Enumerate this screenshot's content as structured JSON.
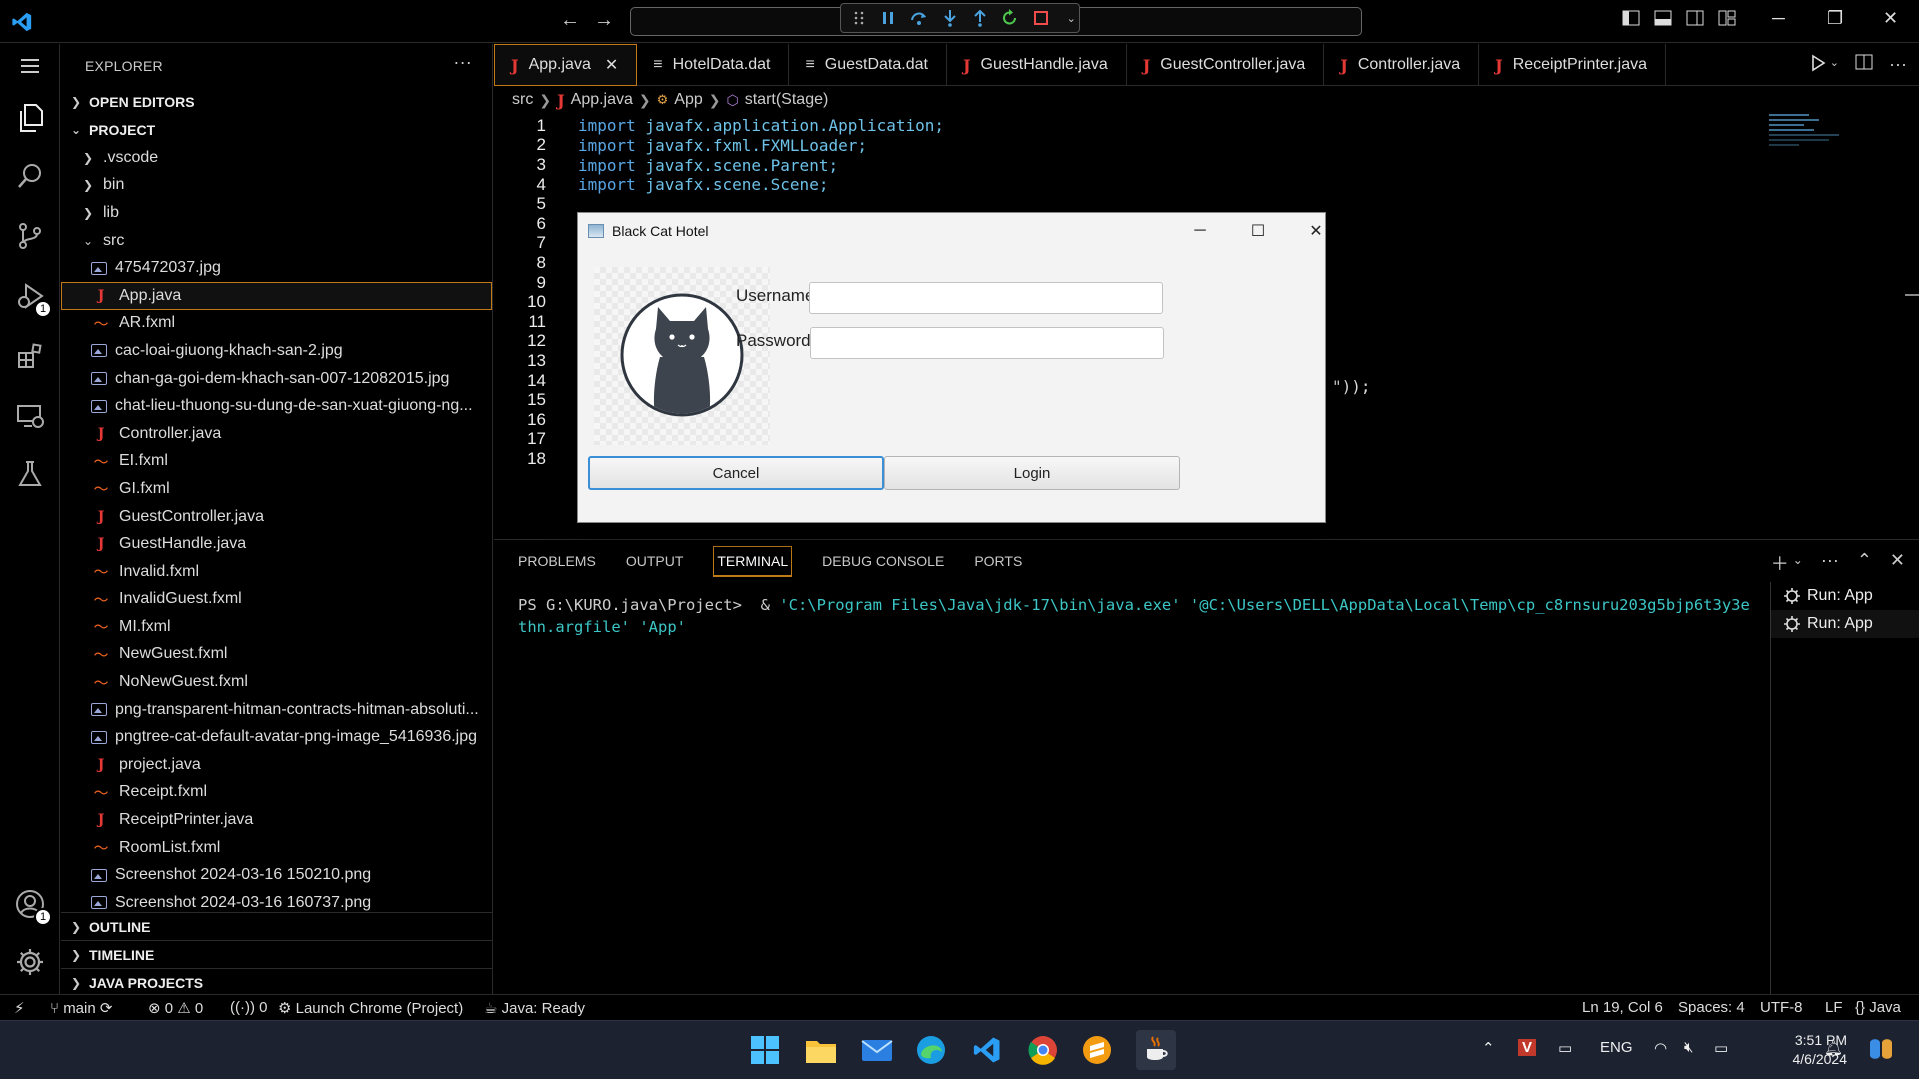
{
  "titlebar": {
    "debug_controls": [
      "drag-handle",
      "pause",
      "step-over",
      "step-into",
      "step-out",
      "restart",
      "stop"
    ]
  },
  "sidebar": {
    "title": "EXPLORER",
    "more": "···",
    "open_editors": "OPEN EDITORS",
    "project": "PROJECT",
    "folders": [
      ".vscode",
      "bin",
      "lib"
    ],
    "src_folder": "src",
    "files": [
      {
        "name": "475472037.jpg",
        "type": "img"
      },
      {
        "name": "App.java",
        "type": "java",
        "active": true
      },
      {
        "name": "AR.fxml",
        "type": "xml"
      },
      {
        "name": "cac-loai-giuong-khach-san-2.jpg",
        "type": "img"
      },
      {
        "name": "chan-ga-goi-dem-khach-san-007-12082015.jpg",
        "type": "img"
      },
      {
        "name": "chat-lieu-thuong-su-dung-de-san-xuat-giuong-ng...",
        "type": "img"
      },
      {
        "name": "Controller.java",
        "type": "java"
      },
      {
        "name": "EI.fxml",
        "type": "xml"
      },
      {
        "name": "GI.fxml",
        "type": "xml"
      },
      {
        "name": "GuestController.java",
        "type": "java"
      },
      {
        "name": "GuestHandle.java",
        "type": "java"
      },
      {
        "name": "Invalid.fxml",
        "type": "xml"
      },
      {
        "name": "InvalidGuest.fxml",
        "type": "xml"
      },
      {
        "name": "MI.fxml",
        "type": "xml"
      },
      {
        "name": "NewGuest.fxml",
        "type": "xml"
      },
      {
        "name": "NoNewGuest.fxml",
        "type": "xml"
      },
      {
        "name": "png-transparent-hitman-contracts-hitman-absoluti...",
        "type": "img"
      },
      {
        "name": "pngtree-cat-default-avatar-png-image_5416936.jpg",
        "type": "img"
      },
      {
        "name": "project.java",
        "type": "java"
      },
      {
        "name": "Receipt.fxml",
        "type": "xml"
      },
      {
        "name": "ReceiptPrinter.java",
        "type": "java"
      },
      {
        "name": "RoomList.fxml",
        "type": "xml"
      },
      {
        "name": "Screenshot 2024-03-16 150210.png",
        "type": "img"
      },
      {
        "name": "Screenshot 2024-03-16 160737.png",
        "type": "img"
      }
    ],
    "outline": "OUTLINE",
    "timeline": "TIMELINE",
    "java_projects": "JAVA PROJECTS"
  },
  "tabs": [
    {
      "label": "App.java",
      "type": "java",
      "active": true
    },
    {
      "label": "HotelData.dat",
      "type": "dat"
    },
    {
      "label": "GuestData.dat",
      "type": "dat"
    },
    {
      "label": "GuestHandle.java",
      "type": "java"
    },
    {
      "label": "GuestController.java",
      "type": "java"
    },
    {
      "label": "Controller.java",
      "type": "java"
    },
    {
      "label": "ReceiptPrinter.java",
      "type": "java"
    }
  ],
  "breadcrumb": [
    "src",
    "App.java",
    "App",
    "start(Stage)"
  ],
  "editor": {
    "lines": [
      {
        "n": "1",
        "kw": "import",
        "rest": " javafx.application.Application;"
      },
      {
        "n": "2",
        "kw": "import",
        "rest": " javafx.fxml.FXMLLoader;"
      },
      {
        "n": "3",
        "kw": "import",
        "rest": " javafx.scene.Parent;"
      },
      {
        "n": "4",
        "kw": "import",
        "rest": " javafx.scene.Scene;"
      },
      {
        "n": "5",
        "kw": "",
        "rest": ""
      },
      {
        "n": "6",
        "kw": "",
        "rest": ""
      },
      {
        "n": "7",
        "kw": "",
        "rest": ""
      },
      {
        "n": "8",
        "kw": "",
        "rest": ""
      },
      {
        "n": "9",
        "kw": "",
        "rest": ""
      },
      {
        "n": "10",
        "kw": "",
        "rest": ""
      },
      {
        "n": "11",
        "kw": "",
        "rest": ""
      },
      {
        "n": "12",
        "kw": "",
        "rest": ""
      },
      {
        "n": "13",
        "kw": "",
        "rest": ""
      },
      {
        "n": "14",
        "kw": "",
        "rest": ""
      },
      {
        "n": "15",
        "kw": "",
        "rest": ""
      },
      {
        "n": "16",
        "kw": "",
        "rest": ""
      },
      {
        "n": "17",
        "kw": "",
        "rest": ""
      },
      {
        "n": "18",
        "kw": "",
        "rest": "}"
      }
    ],
    "line12_tail": "\"));"
  },
  "panel": {
    "tabs": [
      "PROBLEMS",
      "OUTPUT",
      "TERMINAL",
      "DEBUG CONSOLE",
      "PORTS"
    ],
    "active_tab": "TERMINAL",
    "prompt": "PS G:\\KURO.java\\Project> ",
    "command_amp": " & ",
    "command_exe": "'C:\\Program Files\\Java\\jdk-17\\bin\\java.exe'",
    "command_argfile": "'@C:\\Users\\DELL\\AppData\\Local\\Temp\\cp_c8rnsuru203g5bjp6t3y3ethn.argfile'",
    "command_class": "'App'",
    "terminals": [
      "Run: App",
      "Run: App"
    ]
  },
  "statusbar": {
    "branch": "main",
    "errors": "0",
    "warnings": "0",
    "ports": "0",
    "launch": "Launch Chrome (Project)",
    "java": "Java: Ready",
    "position": "Ln 19, Col 6",
    "spaces": "Spaces: 4",
    "encoding": "UTF-8",
    "eol": "LF",
    "language": "Java"
  },
  "dialog": {
    "title": "Black Cat Hotel",
    "username_label": "Username:",
    "password_label": "Password:",
    "username_value": "",
    "password_value": "",
    "cancel": "Cancel",
    "login": "Login"
  },
  "taskbar": {
    "language": "ENG",
    "time": "3:51 PM",
    "date": "4/6/2024"
  },
  "badges": {
    "run_debug": "1",
    "accounts": "1"
  },
  "colors": {
    "accent_border": "#c07a17",
    "java_icon": "#e53935",
    "xml_icon": "#f26522",
    "code": "#6ec2e8",
    "terminal_string": "#3cc6c6"
  }
}
